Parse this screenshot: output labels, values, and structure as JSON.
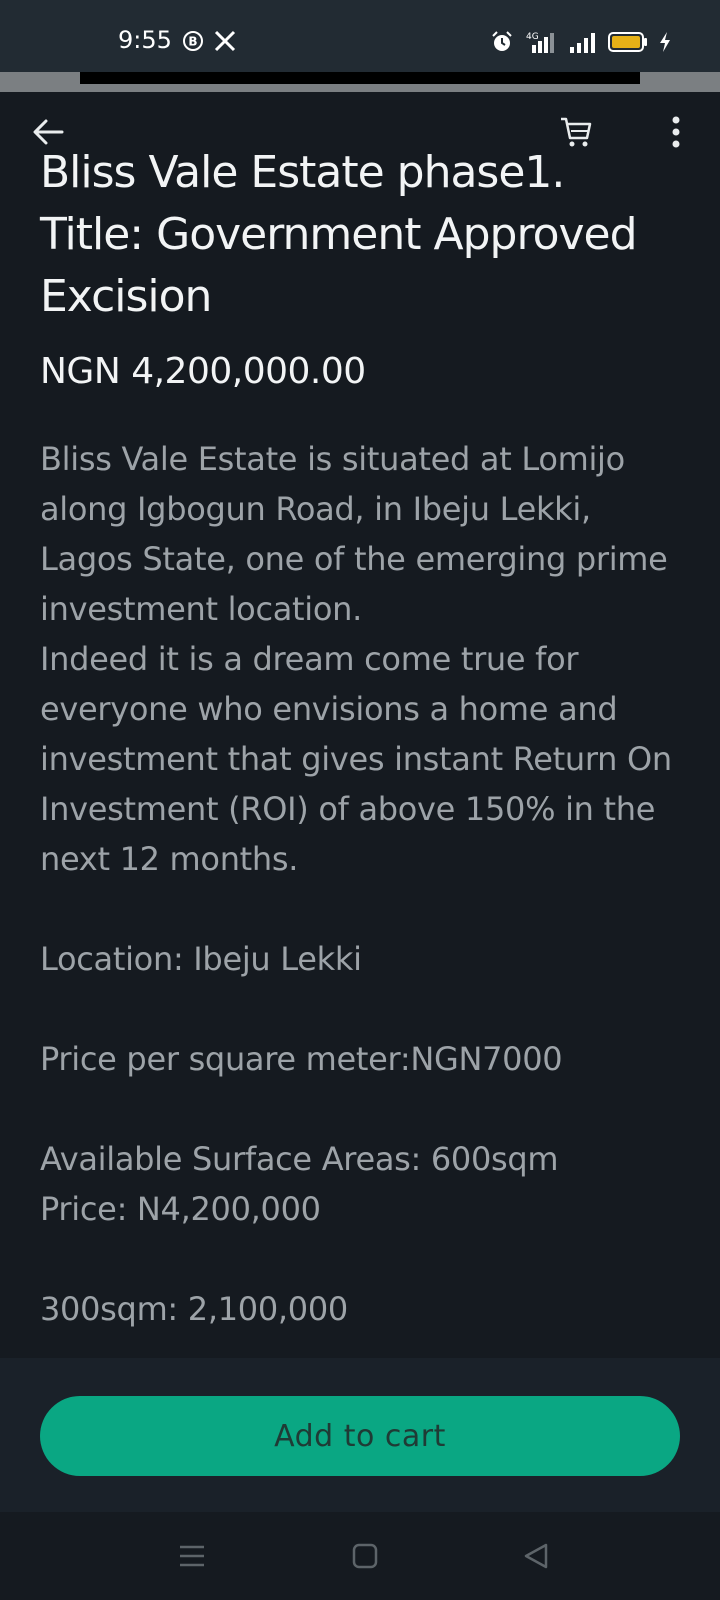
{
  "status_bar": {
    "time": "9:55",
    "network_label": "4G",
    "icons": [
      "b-circle-icon",
      "x-logo-icon",
      "alarm-icon",
      "signal-icon",
      "signal-icon",
      "battery-icon",
      "charging-icon"
    ],
    "battery_color": "#e6b117"
  },
  "header": {
    "icons": [
      "back-arrow-icon",
      "cart-icon",
      "more-vertical-icon"
    ]
  },
  "product": {
    "title": "Bliss Vale Estate phase1. Title: Government Approved Excision",
    "price": "NGN 4,200,000.00",
    "description": {
      "para1": "Bliss Vale Estate is situated at Lomijo along Igbogun Road, in Ibeju Lekki, Lagos State, one of the emerging prime investment location.",
      "para2": "Indeed it is a dream come true for everyone who envisions a home and investment that gives instant Return On Investment (ROI) of above 150% in the next 12 months.",
      "location": "Location: Ibeju Lekki",
      "price_per_sqm": "Price per square meter:NGN7000",
      "available_area": "Available Surface Areas: 600sqm",
      "available_price": "Price: N4,200,000",
      "option_300": "300sqm: 2,100,000"
    }
  },
  "actions": {
    "add_to_cart_label": "Add to cart",
    "accent_color": "#0aa783"
  },
  "nav_bar": {
    "icons": [
      "menu-icon",
      "home-square-icon",
      "back-triangle-icon"
    ]
  }
}
